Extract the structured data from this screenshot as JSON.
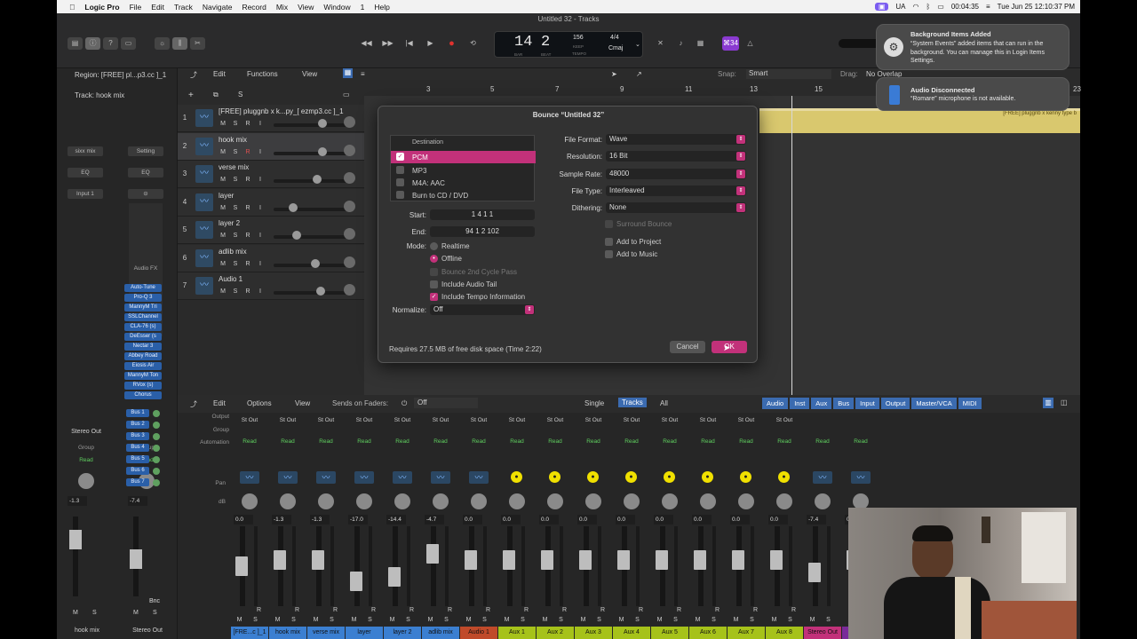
{
  "menubar": {
    "app": "Logic Pro",
    "items": [
      "File",
      "Edit",
      "Track",
      "Navigate",
      "Record",
      "Mix",
      "View",
      "Window",
      "1",
      "Help"
    ],
    "ua": "UA",
    "clock": "Tue Jun 25  12:10:37 PM",
    "timer": "00:04:35"
  },
  "window": {
    "title": "Untitled 32 - Tracks"
  },
  "lcd": {
    "bar": "14",
    "beat": "2",
    "bar_cap": "BAR",
    "beat_cap": "BEAT",
    "tempo": "156",
    "tempo_cap": "KEEP",
    "tempo_sub": "TEMPO",
    "sig": "4/4",
    "key": "Cmaj",
    "badge": "⌘34"
  },
  "inspector": {
    "region": "Region: [FREE] pl...p3.cc ]_1",
    "track": "Track: hook mix",
    "left_setting": "sixx mix",
    "right_setting": "Setting",
    "eq": "EQ",
    "input": "Input 1",
    "audio_fx": "Audio FX",
    "plugins": [
      "Auto-Tune",
      "Pro-Q 3",
      "MannyM Tri",
      "SSLChannel",
      "CLA-76 (s)",
      "DeEsser (s",
      "Nectar 3",
      "Abbey Road",
      "Eiosis Air",
      "MannyM Ton",
      "RVox (s)",
      "Chorus"
    ],
    "buses": [
      "Bus 1",
      "Bus 2",
      "Bus 3",
      "Bus 4",
      "Bus 5",
      "Bus 6",
      "Bus 7"
    ],
    "stereo_out": "Stereo Out",
    "group": "Group",
    "read": "Read",
    "left_db": "-1.3",
    "right_db": "-7.4",
    "left_name": "hook mix",
    "right_name": "Stereo Out",
    "bnc": "Bnc",
    "m": "M",
    "s": "S"
  },
  "tracks_toolbar": {
    "edit": "Edit",
    "functions": "Functions",
    "view": "View",
    "snap_label": "Snap:",
    "snap": "Smart",
    "drag_label": "Drag:",
    "drag": "No Overlap"
  },
  "tracks": [
    {
      "num": "1",
      "name": "[FREE] pluggnb x k...py_[ ezmp3.cc ]_1"
    },
    {
      "num": "2",
      "name": "hook mix"
    },
    {
      "num": "3",
      "name": "verse mix"
    },
    {
      "num": "4",
      "name": "layer"
    },
    {
      "num": "5",
      "name": "layer 2"
    },
    {
      "num": "6",
      "name": "adlib mix"
    },
    {
      "num": "7",
      "name": "Audio 1"
    }
  ],
  "track_buttons": {
    "m": "M",
    "s": "S",
    "r": "R",
    "i": "I"
  },
  "ruler": [
    "3",
    "5",
    "7",
    "9",
    "11",
    "13",
    "15",
    "23"
  ],
  "region_label": "[FREE] pluggnb x kenny type b",
  "bounce": {
    "title": "Bounce “Untitled 32”",
    "dest_header": "Destination",
    "destinations": [
      "PCM",
      "MP3",
      "M4A: AAC",
      "Burn to CD / DVD"
    ],
    "start_label": "Start:",
    "start": "1  4  1     1",
    "end_label": "End:",
    "end": "94  1  2  102",
    "mode_label": "Mode:",
    "realtime": "Realtime",
    "offline": "Offline",
    "bounce2nd": "Bounce 2nd Cycle Pass",
    "audio_tail": "Include Audio Tail",
    "tempo_info": "Include Tempo Information",
    "normalize_label": "Normalize:",
    "normalize": "Off",
    "file_format_label": "File Format:",
    "file_format": "Wave",
    "resolution_label": "Resolution:",
    "resolution": "16 Bit",
    "sample_rate_label": "Sample Rate:",
    "sample_rate": "48000",
    "file_type_label": "File Type:",
    "file_type": "Interleaved",
    "dithering_label": "Dithering:",
    "dithering": "None",
    "surround": "Surround Bounce",
    "add_project": "Add to Project",
    "add_music": "Add to Music",
    "requirement": "Requires 27.5 MB of free disk space  (Time 2:22)",
    "cancel": "Cancel",
    "ok": "OK"
  },
  "mixer_toolbar": {
    "edit": "Edit",
    "options": "Options",
    "view": "View",
    "sends_label": "Sends on Faders:",
    "sends": "Off",
    "single": "Single",
    "tracks": "Tracks",
    "all": "All",
    "filters": [
      "Audio",
      "Inst",
      "Aux",
      "Bus",
      "Input",
      "Output",
      "Master/VCA",
      "MIDI"
    ]
  },
  "mixer_rows": {
    "output": "Output",
    "group": "Group",
    "automation": "Automation",
    "pan": "Pan",
    "db": "dB"
  },
  "strips": [
    {
      "out": "St Out",
      "read": "Read",
      "db": "0.0",
      "name": "[FRE...c ]_1",
      "color": "#3b7fd1",
      "type": "audio"
    },
    {
      "out": "St Out",
      "read": "Read",
      "db": "-1.3",
      "name": "hook mix",
      "color": "#3b7fd1",
      "type": "audio"
    },
    {
      "out": "St Out",
      "read": "Read",
      "db": "-1.3",
      "name": "verse mix",
      "color": "#3b7fd1",
      "type": "audio"
    },
    {
      "out": "St Out",
      "read": "Read",
      "db": "-17.0",
      "name": "layer",
      "color": "#3b7fd1",
      "type": "audio"
    },
    {
      "out": "St Out",
      "read": "Read",
      "db": "-14.4",
      "name": "layer 2",
      "color": "#3b7fd1",
      "type": "audio"
    },
    {
      "out": "St Out",
      "read": "Read",
      "db": "-4.7",
      "name": "adlib mix",
      "color": "#3b7fd1",
      "type": "audio"
    },
    {
      "out": "St Out",
      "read": "Read",
      "db": "0.0",
      "name": "Audio 1",
      "color": "#c04a2a",
      "type": "audio"
    },
    {
      "out": "St Out",
      "read": "Read",
      "db": "0.0",
      "name": "Aux 1",
      "color": "#a6c21a",
      "type": "aux"
    },
    {
      "out": "St Out",
      "read": "Read",
      "db": "0.0",
      "name": "Aux 2",
      "color": "#a6c21a",
      "type": "aux"
    },
    {
      "out": "St Out",
      "read": "Read",
      "db": "0.0",
      "name": "Aux 3",
      "color": "#a6c21a",
      "type": "aux"
    },
    {
      "out": "St Out",
      "read": "Read",
      "db": "0.0",
      "name": "Aux 4",
      "color": "#a6c21a",
      "type": "aux"
    },
    {
      "out": "St Out",
      "read": "Read",
      "db": "0.0",
      "name": "Aux 5",
      "color": "#a6c21a",
      "type": "aux"
    },
    {
      "out": "St Out",
      "read": "Read",
      "db": "0.0",
      "name": "Aux 6",
      "color": "#a6c21a",
      "type": "aux"
    },
    {
      "out": "St Out",
      "read": "Read",
      "db": "0.0",
      "name": "Aux 7",
      "color": "#a6c21a",
      "type": "aux"
    },
    {
      "out": "St Out",
      "read": "Read",
      "db": "0.0",
      "name": "Aux 8",
      "color": "#a6c21a",
      "type": "aux"
    },
    {
      "out": "",
      "read": "Read",
      "db": "-7.4",
      "name": "Stereo Out",
      "color": "#c2317a",
      "type": "out"
    },
    {
      "out": "",
      "read": "Read",
      "db": "0.0",
      "name": "",
      "color": "#7a2a9a",
      "type": "out2"
    }
  ],
  "notifications": [
    {
      "title": "Background Items Added",
      "body": "“System Events” added items that can run in the background. You can manage this in Login Items Settings."
    },
    {
      "title": "Audio Disconnected",
      "body": "“Romare” microphone is not available."
    }
  ]
}
